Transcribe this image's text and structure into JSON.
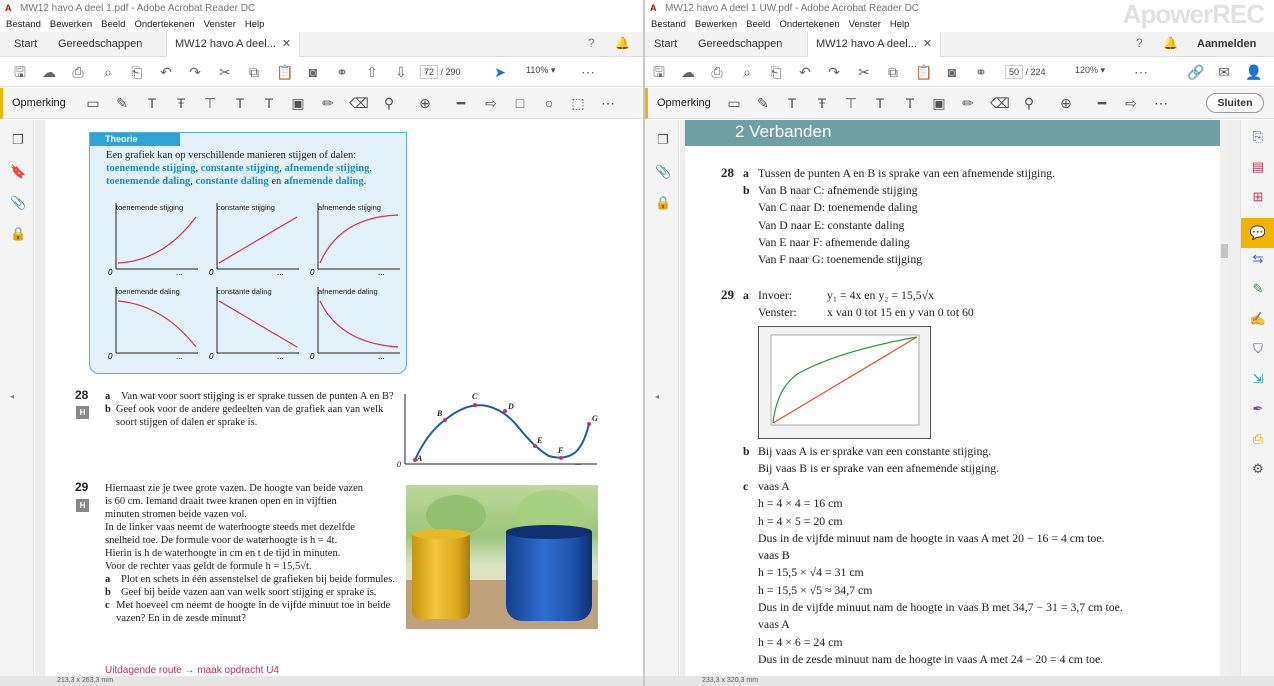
{
  "left": {
    "title": "MW12 havo A deel 1.pdf - Adobe Acrobat Reader DC",
    "menu": [
      "Bestand",
      "Bewerken",
      "Beeld",
      "Ondertekenen",
      "Venster",
      "Help"
    ],
    "tabs": {
      "start": "Start",
      "tools": "Gereedschappen",
      "doc": "MW12 havo A deel..."
    },
    "page": {
      "current": "72",
      "total": "/ 290"
    },
    "zoom": "110%",
    "comment_label": "Opmerking",
    "statusbar": "213,3 x 263,3 mm",
    "theory": {
      "header": "Theorie",
      "intro": "Een grafiek kan op verschillende manieren stijgen of dalen:",
      "t1": "toenemende stijging",
      "t2": "constante stijging",
      "t3": "afnemende stijging",
      "t4": "toenemende daling",
      "t5": "constante daling",
      "t6": "en",
      "t7": "afnemende daling",
      "c1": "toenemende stijging",
      "c2": "constante stijging",
      "c3": "afnemende stijging",
      "c4": "toenemende daling",
      "c5": "constante daling",
      "c6": "afnemende daling",
      "zero": "0",
      "dots": "..."
    },
    "q28": {
      "num": "28",
      "h": "H",
      "a": "Van wat voor soort stijging is er sprake tussen de punten A en B?",
      "b": "Geef ook voor de andere gedeelten van de grafiek aan van welk soort stijgen of dalen er sprake is.",
      "points": [
        "A",
        "B",
        "C",
        "D",
        "E",
        "F",
        "G"
      ],
      "zero": "0",
      "dots": "..."
    },
    "q29": {
      "num": "29",
      "h": "H",
      "l1": "Hiernaast zie je twee grote vazen. De hoogte van beide vazen",
      "l2": "is 60 cm. Iemand draait twee kranen open en in vijftien",
      "l3": "minuten stromen beide vazen vol.",
      "l4": "In de linker vaas neemt de waterhoogte steeds met dezelfde",
      "l5": "snelheid toe. De formule voor de waterhoogte is h = 4t.",
      "l6": "Hierin is h de waterhoogte in cm en t de tijd in minuten.",
      "l7": "Voor de rechter vaas geldt de formule h = 15,5√t.",
      "a": "Plot en schets in één assenstelsel de grafieken bij beide formules.",
      "b": "Geef bij beide vazen aan van welk soort stijging er sprake is.",
      "c": "Met hoeveel cm neemt de hoogte in de vijfde minuut toe in beide vazen? En in de zesde minuut?",
      "route": "Uitdagende route → maak opdracht U4"
    }
  },
  "right": {
    "title": "MW12 havo A deel 1 UW.pdf - Adobe Acrobat Reader DC",
    "watermark": "ApowerREC",
    "menu": [
      "Bestand",
      "Bewerken",
      "Beeld",
      "Ondertekenen",
      "Venster",
      "Help"
    ],
    "tabs": {
      "start": "Start",
      "tools": "Gereedschappen",
      "doc": "MW12 havo A deel...",
      "signin": "Aanmelden"
    },
    "page": {
      "current": "50",
      "total": "/ 224"
    },
    "zoom": "120%",
    "comment_label": "Opmerking",
    "close_label": "Sluiten",
    "statusbar": "233,3 x 320,3 mm",
    "chapter": "2  Verbanden",
    "a28": {
      "num": "28",
      "a": "Tussen de punten A en B is sprake van een afnemende stijging.",
      "b1": "Van B naar C: afnemende stijging",
      "b2": "Van C naar D: toenemende daling",
      "b3": "Van D naar E: constante daling",
      "b4": "Van E naar F: afnemende daling",
      "b5": "Van F naar G: toenemende stijging"
    },
    "a29": {
      "num": "29",
      "invoer": "Invoer:",
      "invoer_val": "y₁ = 4x en y₂ = 15,5√x",
      "venster": "Venster:",
      "venster_val": "x van 0 tot 15 en y van 0 tot 60",
      "b1": "Bij vaas A is er sprake van een constante stijging.",
      "b2": "Bij vaas B is er sprake van een afnemende stijging.",
      "c": "vaas A",
      "c1": "h = 4 × 4 = 16 cm",
      "c2": "h = 4 × 5 = 20 cm",
      "c3": "Dus in de vijfde minuut nam de hoogte in vaas A met 20 − 16 = 4 cm toe.",
      "c4": "vaas B",
      "c5": "h = 15,5 × √4 = 31 cm",
      "c6": "h = 15,5 × √5 ≈ 34,7 cm",
      "c7": "Dus in de vijfde minuut nam de hoogte in vaas B met 34,7 − 31 = 3,7 cm toe.",
      "c8": "vaas A",
      "c9": "h = 4 × 6 = 24 cm",
      "c10": "Dus in de zesde minuut nam de hoogte in vaas A met 24 − 20 = 4 cm toe."
    }
  },
  "colors": {
    "accent": "#f2b400",
    "theory_blue": "#1d8ec5",
    "teal": "#6e9fa4",
    "curve": "#d0305a"
  }
}
